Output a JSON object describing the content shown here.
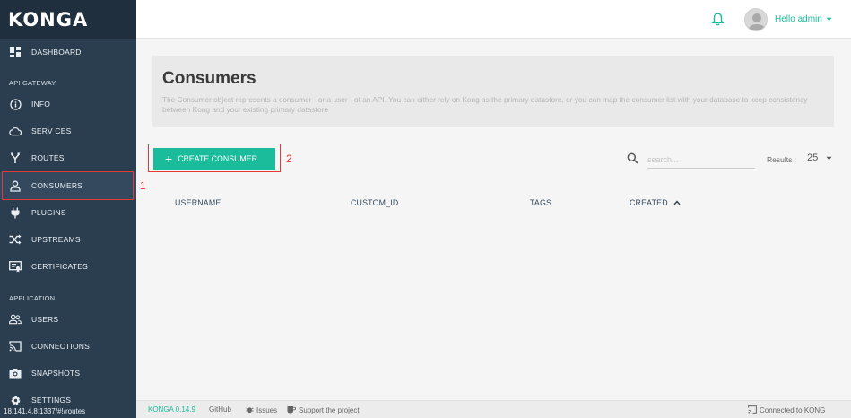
{
  "brand": "KONGA",
  "sidebar": {
    "items": [
      {
        "label": "DASHBOARD",
        "icon": "dashboard-icon"
      },
      {
        "label": "INFO",
        "icon": "info-icon"
      },
      {
        "label": "SERV CES",
        "icon": "cloud-icon"
      },
      {
        "label": "ROUTES",
        "icon": "routes-icon"
      },
      {
        "label": "CONSUMERS",
        "icon": "user-icon"
      },
      {
        "label": "PLUGINS",
        "icon": "plug-icon"
      },
      {
        "label": "UPSTREAMS",
        "icon": "shuffle-icon"
      },
      {
        "label": "CERTIFICATES",
        "icon": "certificate-icon"
      },
      {
        "label": "USERS",
        "icon": "users-icon"
      },
      {
        "label": "CONNECTIONS",
        "icon": "cast-icon"
      },
      {
        "label": "SNAPSHOTS",
        "icon": "camera-icon"
      },
      {
        "label": "SETTINGS",
        "icon": "gear-icon"
      }
    ],
    "sections": {
      "api_gateway": "API GATEWAY",
      "application": "APPLICATION"
    }
  },
  "callouts": {
    "one": "1",
    "two": "2"
  },
  "topbar": {
    "user_greeting": "Hello admin"
  },
  "header": {
    "title": "Consumers",
    "description": "The Consumer object represents a consumer - or a user - of an API. You can either rely on Kong as the primary datastore, or you can map the consumer list with your database to keep consistency between Kong and your existing primary datastore"
  },
  "toolbar": {
    "create_label": "CREATE CONSUMER",
    "search_placeholder": "search...",
    "results_label": "Results :",
    "results_value": "25"
  },
  "table": {
    "columns": [
      "USERNAME",
      "CUSTOM_ID",
      "TAGS",
      "CREATED"
    ]
  },
  "footer": {
    "version": "KONGA 0.14.9",
    "github": "GitHub",
    "issues": "Issues",
    "support": "Support the project",
    "connected": "Connected to KONG"
  },
  "status_url": "18.141.4.8:1337/#!/routes",
  "colors": {
    "sidebar": "#2b3e50",
    "accent": "#1abc9c",
    "highlight": "#e53935"
  }
}
